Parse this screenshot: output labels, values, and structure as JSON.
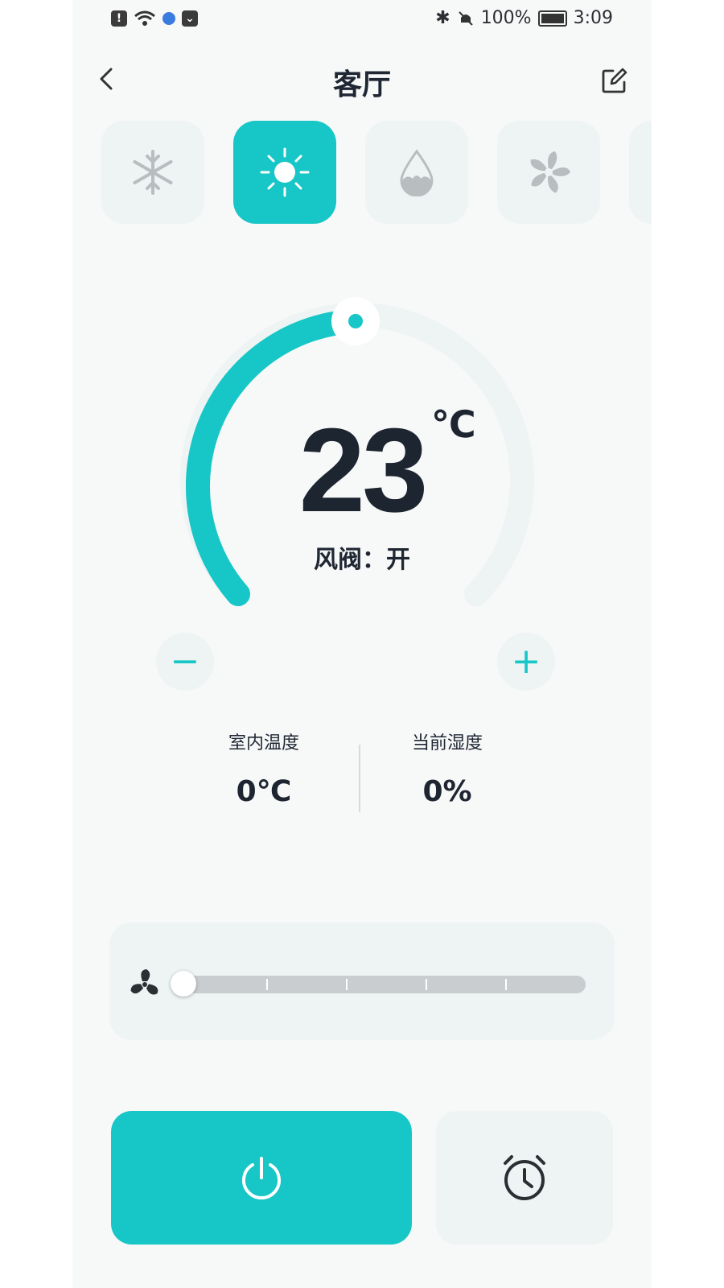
{
  "status_bar": {
    "battery": "100%",
    "time": "3:09"
  },
  "header": {
    "title": "客厅"
  },
  "modes": [
    {
      "name": "snowflake-icon"
    },
    {
      "name": "sun-icon",
      "active": true
    },
    {
      "name": "droplet-icon"
    },
    {
      "name": "fan-icon"
    }
  ],
  "thermostat": {
    "temperature": "23",
    "unit": "℃",
    "valve_status": "风阀：开",
    "decrease": "−",
    "increase": "+"
  },
  "stats": {
    "indoor_temp": {
      "label": "室内温度",
      "value": "0℃"
    },
    "humidity": {
      "label": "当前湿度",
      "value": "0%"
    }
  },
  "fan_speed": {
    "level": 0,
    "steps": 5
  },
  "colors": {
    "accent": "#17c6c6",
    "text": "#1d2531",
    "card": "#eef4f4"
  }
}
